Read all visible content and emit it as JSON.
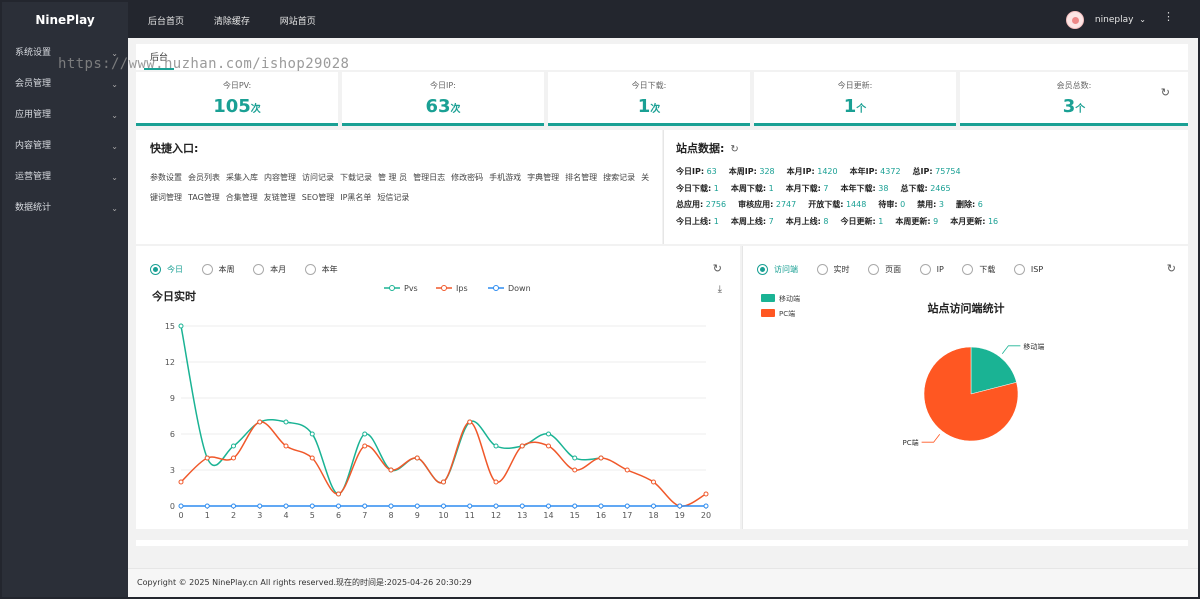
{
  "app": {
    "brand": "NinePlay"
  },
  "sidebar": {
    "items": [
      {
        "label": "系统设置"
      },
      {
        "label": "会员管理"
      },
      {
        "label": "应用管理"
      },
      {
        "label": "内容管理"
      },
      {
        "label": "运营管理"
      },
      {
        "label": "数据统计"
      }
    ]
  },
  "header": {
    "nav": [
      "后台首页",
      "清除缓存",
      "网站首页"
    ],
    "username": "nineplay"
  },
  "tabs": {
    "active": "后台"
  },
  "watermark": "https://www.huzhan.com/ishop29028",
  "stats": [
    {
      "label": "今日PV:",
      "value": "105",
      "unit": "次"
    },
    {
      "label": "今日IP:",
      "value": "63",
      "unit": "次"
    },
    {
      "label": "今日下载:",
      "value": "1",
      "unit": "次"
    },
    {
      "label": "今日更新:",
      "value": "1",
      "unit": "个"
    },
    {
      "label": "会员总数:",
      "value": "3",
      "unit": "个"
    }
  ],
  "quick": {
    "title": "快捷入口:",
    "links": [
      "参数设置",
      "会员列表",
      "采集入库",
      "内容管理",
      "访问记录",
      "下载记录",
      "管 理 员",
      "管理日志",
      "修改密码",
      "手机游戏",
      "字典管理",
      "排名管理",
      "搜索记录",
      "关键词管理",
      "TAG管理",
      "合集管理",
      "友链管理",
      "SEO管理",
      "IP黑名单",
      "短信记录"
    ]
  },
  "site": {
    "title": "站点数据:",
    "rows": [
      [
        [
          "今日IP:",
          "63"
        ],
        [
          "本周IP:",
          "328"
        ],
        [
          "本月IP:",
          "1420"
        ],
        [
          "本年IP:",
          "4372"
        ],
        [
          "总IP:",
          "75754"
        ]
      ],
      [
        [
          "今日下载:",
          "1"
        ],
        [
          "本周下载:",
          "1"
        ],
        [
          "本月下载:",
          "7"
        ],
        [
          "本年下载:",
          "38"
        ],
        [
          "总下载:",
          "2465"
        ]
      ],
      [
        [
          "总应用:",
          "2756"
        ],
        [
          "审核应用:",
          "2747"
        ],
        [
          "开放下载:",
          "1448"
        ],
        [
          "待审:",
          "0"
        ],
        [
          "禁用:",
          "3"
        ],
        [
          "删除:",
          "6"
        ]
      ],
      [
        [
          "今日上线:",
          "1"
        ],
        [
          "本周上线:",
          "7"
        ],
        [
          "本月上线:",
          "8"
        ],
        [
          "今日更新:",
          "1"
        ],
        [
          "本周更新:",
          "9"
        ],
        [
          "本月更新:",
          "16"
        ]
      ]
    ]
  },
  "left_chart": {
    "radios": [
      "今日",
      "本周",
      "本月",
      "本年"
    ],
    "title": "今日实时"
  },
  "right_chart": {
    "radios": [
      "访问端",
      "实时",
      "页面",
      "IP",
      "下载",
      "ISP"
    ],
    "title": "站点访问端统计"
  },
  "chart_data": [
    {
      "type": "line",
      "title": "今日实时",
      "x": [
        0,
        1,
        2,
        3,
        4,
        5,
        6,
        7,
        8,
        9,
        10,
        11,
        12,
        13,
        14,
        15,
        16,
        17,
        18,
        19,
        20
      ],
      "ylim": [
        0,
        15
      ],
      "yticks": [
        0,
        3,
        6,
        9,
        12,
        15
      ],
      "legend_position": "top-center",
      "series": [
        {
          "name": "Pvs",
          "color": "#1ab394",
          "values": [
            15,
            4,
            5,
            7,
            7,
            6,
            1,
            6,
            3,
            4,
            2,
            7,
            5,
            5,
            6,
            4,
            4,
            null,
            null,
            null,
            null
          ]
        },
        {
          "name": "Ips",
          "color": "#f0582a",
          "values": [
            2,
            4,
            4,
            7,
            5,
            4,
            1,
            5,
            3,
            4,
            2,
            7,
            2,
            5,
            5,
            3,
            4,
            3,
            2,
            0,
            1
          ]
        },
        {
          "name": "Down",
          "color": "#2d8cf0",
          "values": [
            0,
            0,
            0,
            0,
            0,
            0,
            0,
            0,
            0,
            0,
            0,
            0,
            0,
            0,
            0,
            0,
            0,
            0,
            0,
            0,
            0
          ]
        }
      ]
    },
    {
      "type": "pie",
      "title": "站点访问端统计",
      "legend_position": "top-left",
      "categories": [
        "移动端",
        "PC端"
      ],
      "values": [
        21,
        79
      ],
      "colors": [
        "#1ab394",
        "#ff5722"
      ]
    }
  ],
  "footer": {
    "text": "Copyright © 2025 NinePlay.cn All rights reserved.现在的时间是:2025-04-26 20:30:29"
  }
}
